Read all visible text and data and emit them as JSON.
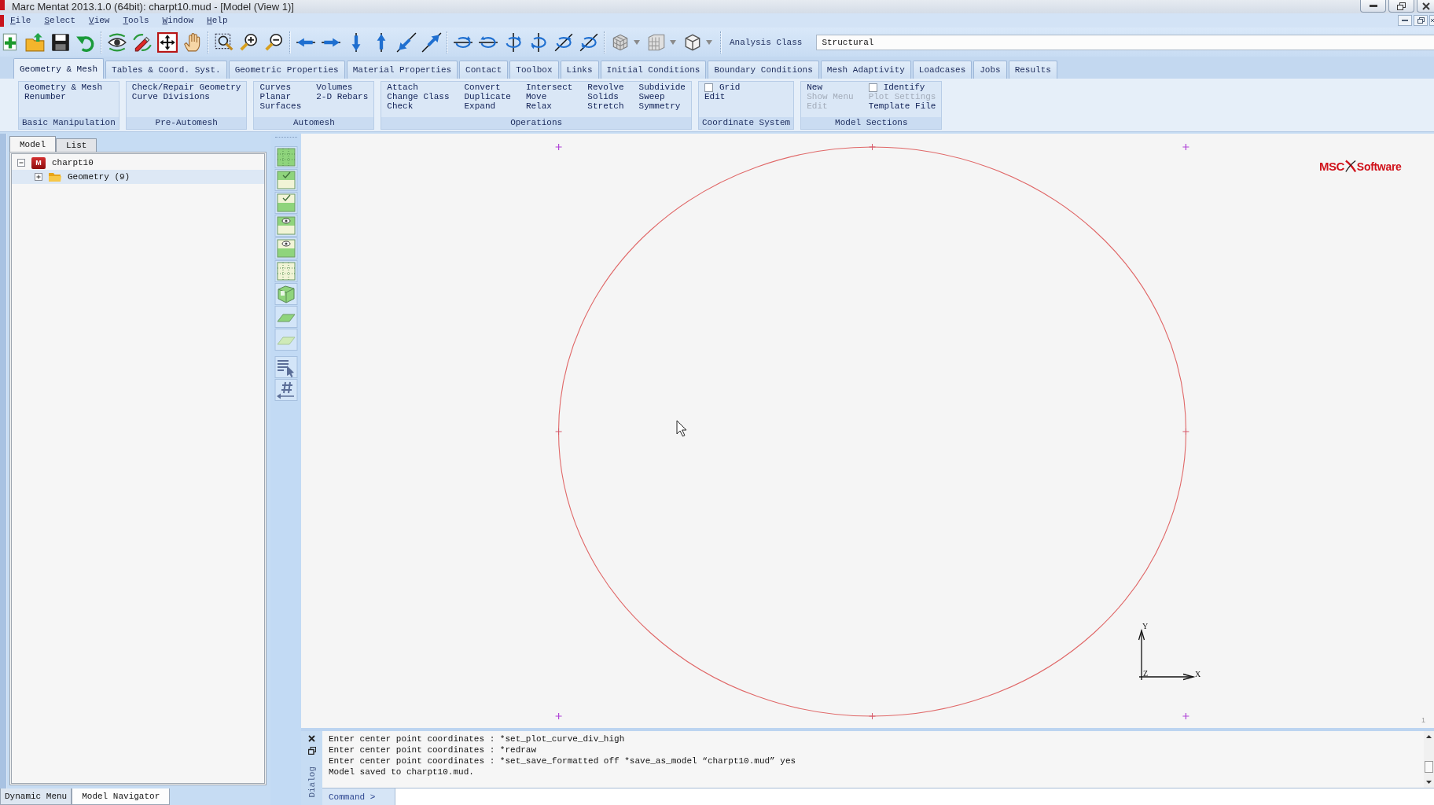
{
  "window": {
    "title": "Marc Mentat 2013.1.0 (64bit): charpt10.mud - [Model (View 1)]"
  },
  "menu_bar": [
    {
      "label": "File"
    },
    {
      "label": "Select"
    },
    {
      "label": "View"
    },
    {
      "label": "Tools"
    },
    {
      "label": "Window"
    },
    {
      "label": "Help"
    }
  ],
  "toolbar": {
    "analysis_class": {
      "label": "Analysis Class",
      "value": "Structural"
    }
  },
  "tabs": [
    {
      "label": "Geometry & Mesh",
      "selected": true
    },
    {
      "label": "Tables & Coord. Syst.",
      "selected": false
    },
    {
      "label": "Geometric Properties",
      "selected": false
    },
    {
      "label": "Material Properties",
      "selected": false
    },
    {
      "label": "Contact",
      "selected": false
    },
    {
      "label": "Toolbox",
      "selected": false
    },
    {
      "label": "Links",
      "selected": false
    },
    {
      "label": "Initial Conditions",
      "selected": false
    },
    {
      "label": "Boundary Conditions",
      "selected": false
    },
    {
      "label": "Mesh Adaptivity",
      "selected": false
    },
    {
      "label": "Loadcases",
      "selected": false
    },
    {
      "label": "Jobs",
      "selected": false
    },
    {
      "label": "Results",
      "selected": false
    }
  ],
  "ribbon": {
    "groups": [
      {
        "title": "Basic Manipulation",
        "columns": [
          [
            {
              "kind": "command",
              "label": "Geometry & Mesh",
              "disabled": false
            },
            {
              "kind": "command",
              "label": "Renumber",
              "disabled": false
            }
          ]
        ]
      },
      {
        "title": "Pre-Automesh",
        "columns": [
          [
            {
              "kind": "command",
              "label": "Check/Repair Geometry",
              "disabled": false
            },
            {
              "kind": "command",
              "label": "Curve Divisions",
              "disabled": false
            }
          ]
        ]
      },
      {
        "title": "Automesh",
        "columns": [
          [
            {
              "kind": "command",
              "label": "Curves",
              "disabled": false
            },
            {
              "kind": "command",
              "label": "Planar",
              "disabled": false
            },
            {
              "kind": "command",
              "label": "Surfaces",
              "disabled": false
            }
          ],
          [
            {
              "kind": "command",
              "label": "Volumes",
              "disabled": false
            },
            {
              "kind": "command",
              "label": "2-D Rebars",
              "disabled": false
            }
          ]
        ]
      },
      {
        "title": "Operations",
        "columns": [
          [
            {
              "kind": "command",
              "label": "Attach",
              "disabled": false
            },
            {
              "kind": "command",
              "label": "Change Class",
              "disabled": false
            },
            {
              "kind": "command",
              "label": "Check",
              "disabled": false
            }
          ],
          [
            {
              "kind": "command",
              "label": "Convert",
              "disabled": false
            },
            {
              "kind": "command",
              "label": "Duplicate",
              "disabled": false
            },
            {
              "kind": "command",
              "label": "Expand",
              "disabled": false
            }
          ],
          [
            {
              "kind": "command",
              "label": "Intersect",
              "disabled": false
            },
            {
              "kind": "command",
              "label": "Move",
              "disabled": false
            },
            {
              "kind": "command",
              "label": "Relax",
              "disabled": false
            }
          ],
          [
            {
              "kind": "command",
              "label": "Revolve",
              "disabled": false
            },
            {
              "kind": "command",
              "label": "Solids",
              "disabled": false
            },
            {
              "kind": "command",
              "label": "Stretch",
              "disabled": false
            }
          ],
          [
            {
              "kind": "command",
              "label": "Subdivide",
              "disabled": false
            },
            {
              "kind": "command",
              "label": "Sweep",
              "disabled": false
            },
            {
              "kind": "command",
              "label": "Symmetry",
              "disabled": false
            }
          ]
        ]
      },
      {
        "title": "Coordinate System",
        "columns": [
          [
            {
              "kind": "checkbox",
              "label": "Grid",
              "checked": false,
              "disabled": false
            },
            {
              "kind": "command",
              "label": "Edit",
              "disabled": false
            }
          ]
        ]
      },
      {
        "title": "Model Sections",
        "columns": [
          [
            {
              "kind": "command",
              "label": "New",
              "disabled": false
            },
            {
              "kind": "command",
              "label": "Show Menu",
              "disabled": true
            },
            {
              "kind": "command",
              "label": "Edit",
              "disabled": true
            }
          ],
          [
            {
              "kind": "checkbox",
              "label": "Identify",
              "checked": false,
              "disabled": false
            },
            {
              "kind": "command",
              "label": "Plot Settings",
              "disabled": true
            },
            {
              "kind": "command",
              "label": "Template File",
              "disabled": false
            }
          ]
        ]
      }
    ]
  },
  "model_panel": {
    "tabs": [
      {
        "label": "Model",
        "selected": true
      },
      {
        "label": "List",
        "selected": false
      }
    ],
    "tree": [
      {
        "label": "charpt10",
        "kind": "model",
        "badge": "M",
        "expanded": true,
        "selected": false,
        "children": [
          {
            "label": "Geometry (9)",
            "kind": "folder",
            "expanded": false,
            "selected": true
          }
        ]
      }
    ]
  },
  "bottom_tabs": [
    {
      "label": "Dynamic Menu",
      "selected": false
    },
    {
      "label": "Model Navigator",
      "selected": true
    }
  ],
  "viewport": {
    "logo": {
      "brand": "MSC",
      "product": "Software"
    },
    "axes": {
      "x": "X",
      "y": "Y",
      "z": "Z"
    },
    "view_number": "1"
  },
  "dialog": {
    "title": "Dialog",
    "lines": [
      "Enter center point coordinates : *set_plot_curve_div_high",
      "Enter center point coordinates : *redraw",
      "Enter center point coordinates : *set_save_formatted off *save_as_model “charpt10.mud” yes",
      "Model saved to charpt10.mud."
    ],
    "command": {
      "label": "Command >"
    }
  }
}
